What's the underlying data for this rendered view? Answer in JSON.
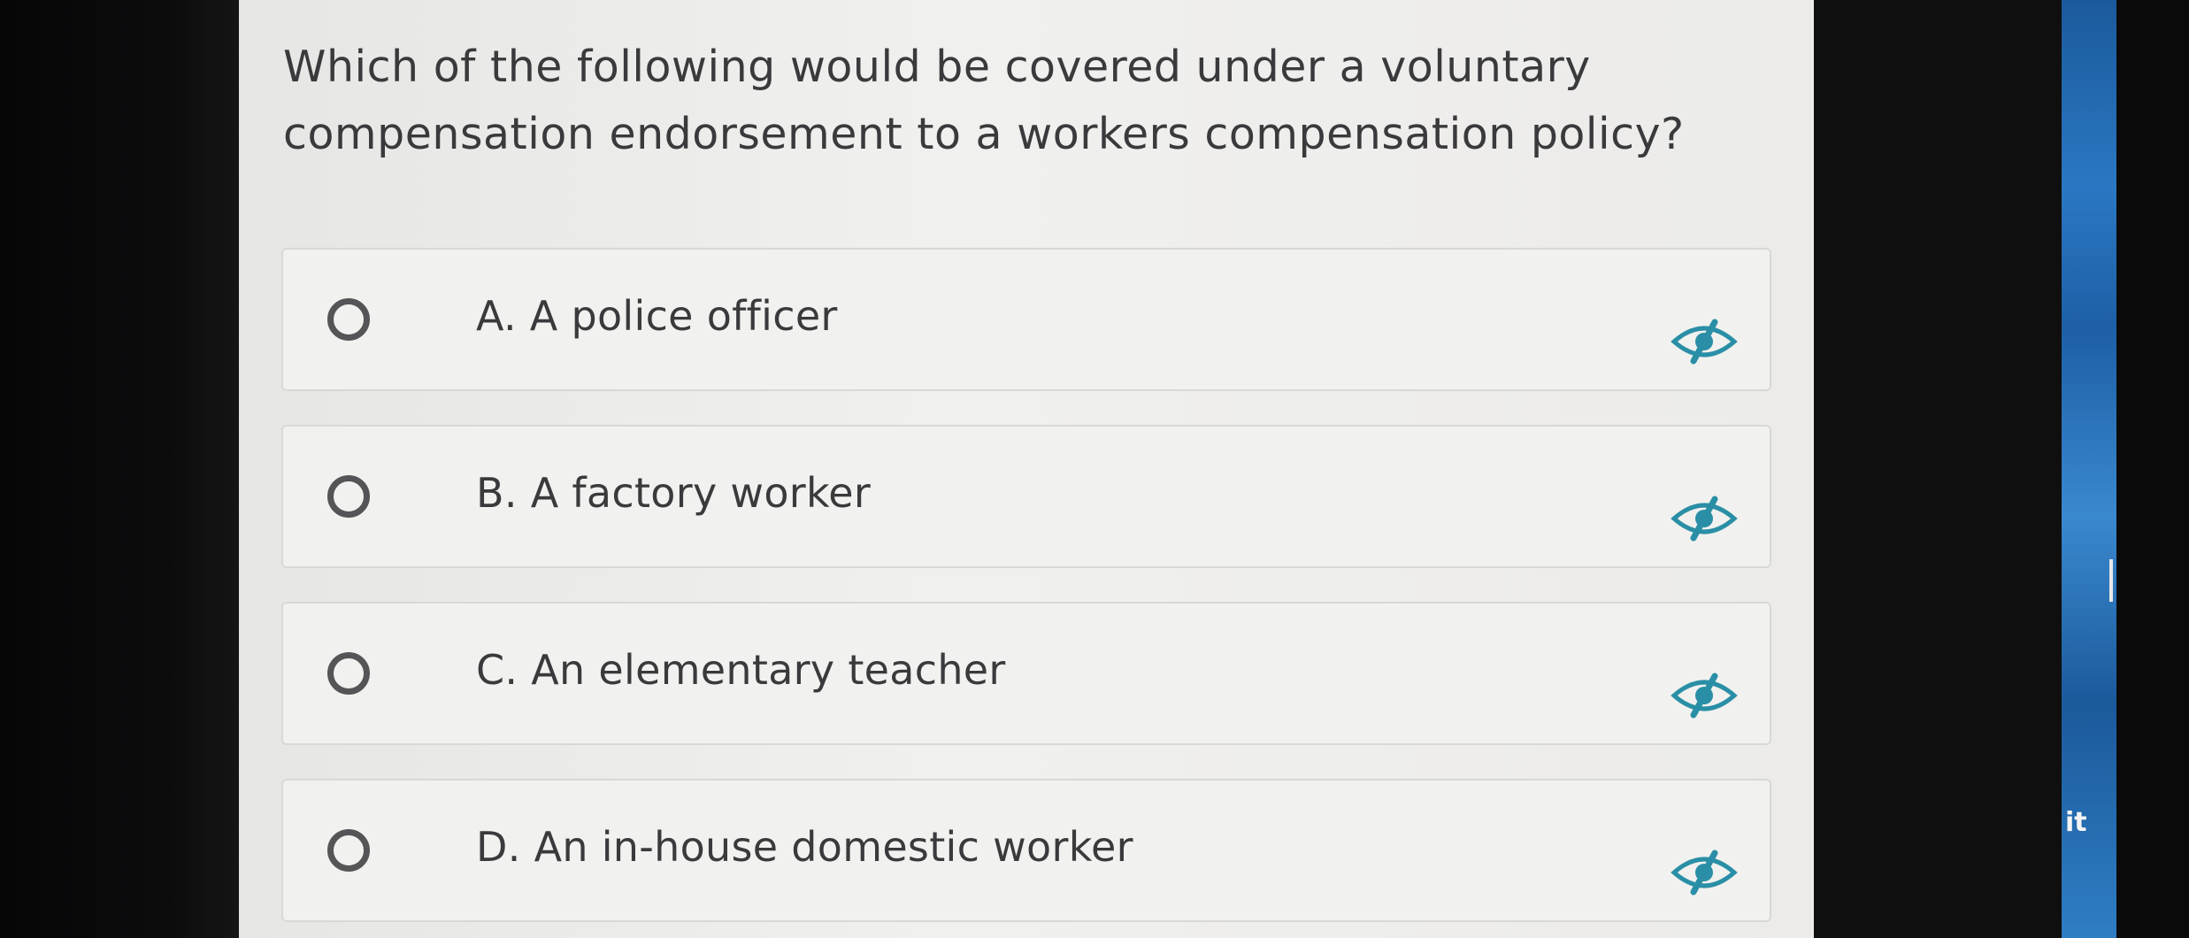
{
  "question": {
    "line1": "Which of the following would be covered under a voluntary",
    "line2": "compensation endorsement to a workers compensation policy?"
  },
  "options": [
    {
      "label": "A. A police officer"
    },
    {
      "label": "B. A factory worker"
    },
    {
      "label": "C. An elementary teacher"
    },
    {
      "label": "D. An in-house domestic worker"
    }
  ],
  "option_icon": "eye-slash-icon",
  "edge_text": "it",
  "colors": {
    "text": "#3a3a3c",
    "panel": "#efefed",
    "radio": "#555557",
    "icon_teal": "#2a8fa6",
    "option_border": "#d8d8d6"
  }
}
